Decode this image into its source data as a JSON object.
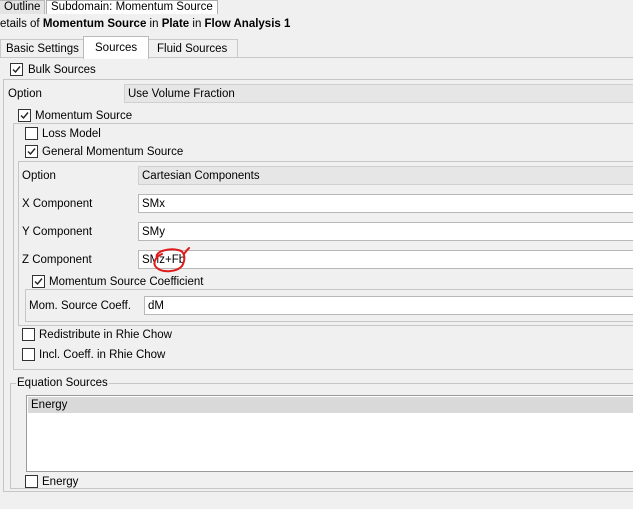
{
  "top_tabs": {
    "outline": "Outline",
    "subdomain": "Subdomain: Momentum Source"
  },
  "header": {
    "prefix": "etails of ",
    "object": "Momentum Source",
    "in1": " in ",
    "domain": "Plate",
    "in2": " in ",
    "analysis": "Flow Analysis 1"
  },
  "section_tabs": {
    "basic": "Basic Settings",
    "sources": "Sources",
    "fluid": "Fluid Sources"
  },
  "bulk_sources": {
    "label": "Bulk Sources",
    "checked": true
  },
  "option1": {
    "label": "Option",
    "value": "Use Volume Fraction"
  },
  "momentum_source": {
    "label": "Momentum Source",
    "checked": true
  },
  "loss_model": {
    "label": "Loss Model",
    "checked": false
  },
  "general_momentum": {
    "label": "General Momentum Source",
    "checked": true
  },
  "option2": {
    "label": "Option",
    "value": "Cartesian Components"
  },
  "x_component": {
    "label": "X Component",
    "value": "SMx"
  },
  "y_component": {
    "label": "Y Component",
    "value": "SMy"
  },
  "z_component": {
    "label": "Z Component",
    "value": "SMz+Fb"
  },
  "momentum_coeff": {
    "label": "Momentum Source Coefficient",
    "checked": true
  },
  "mom_source_coeff": {
    "label": "Mom. Source Coeff.",
    "value": "dM"
  },
  "redistribute": {
    "label": "Redistribute in Rhie Chow",
    "checked": false
  },
  "incl_coeff": {
    "label": "Incl. Coeff. in Rhie Chow",
    "checked": false
  },
  "equation_sources": {
    "label": "Equation Sources",
    "items": [
      "Energy"
    ]
  },
  "energy": {
    "label": "Energy",
    "checked": false
  },
  "colors": {
    "annotation": "#e01b1b",
    "selection": "#d9d9d9"
  }
}
